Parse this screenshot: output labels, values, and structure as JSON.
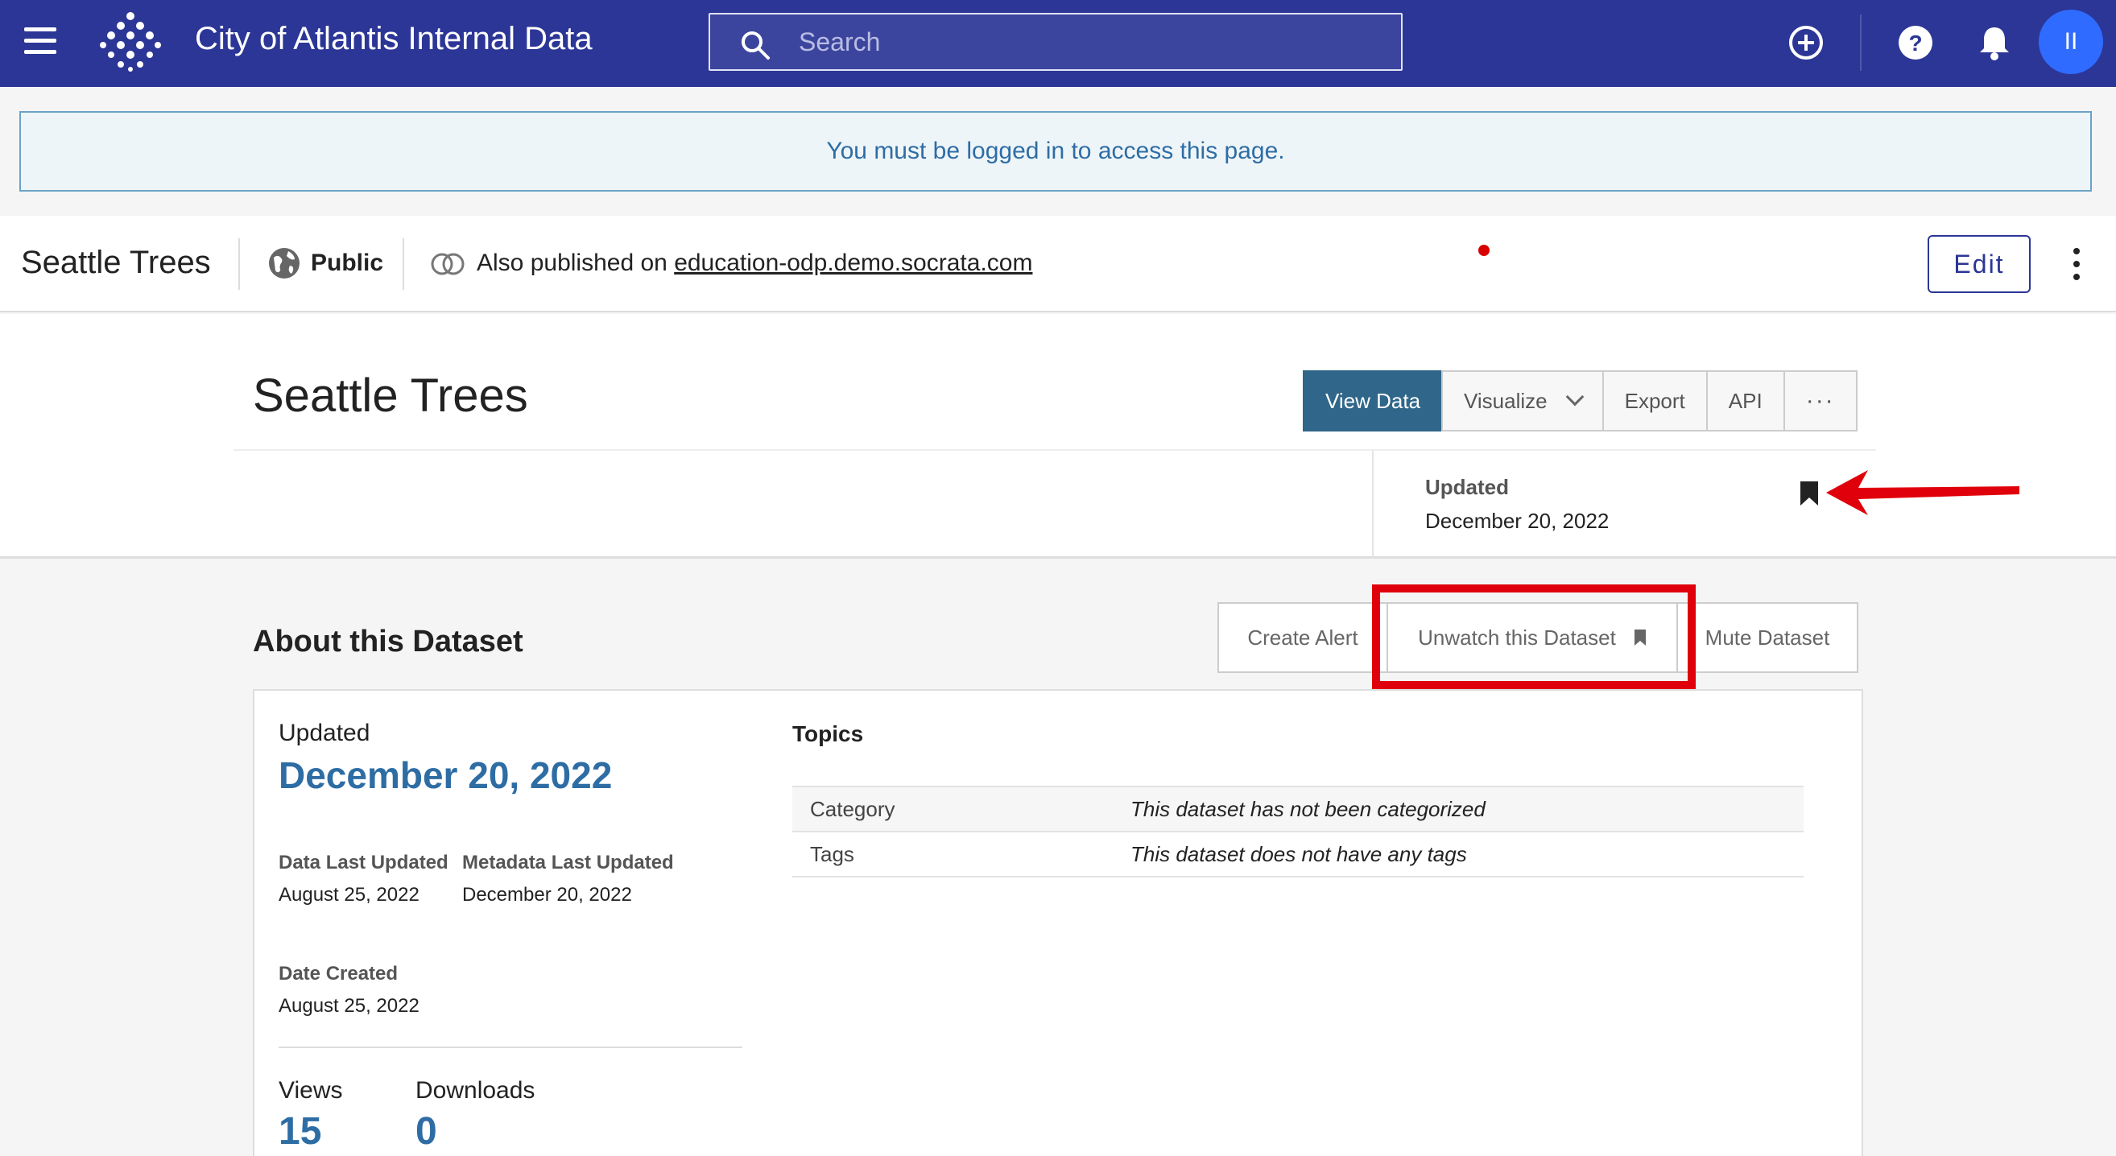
{
  "header": {
    "app_title": "City of Atlantis Internal Data",
    "search_placeholder": "Search",
    "avatar_initials": "II",
    "icons": [
      "menu-icon",
      "logo-icon",
      "search-icon",
      "add-circle-icon",
      "help-icon",
      "bell-icon"
    ]
  },
  "alert": {
    "message": "You must be logged in to access this page."
  },
  "asset_bar": {
    "name": "Seattle Trees",
    "visibility": "Public",
    "published_prefix": "Also published on",
    "published_link": "education-odp.demo.socrata.com",
    "edit_label": "Edit"
  },
  "title_section": {
    "title": "Seattle Trees",
    "buttons": {
      "view_data": "View Data",
      "visualize": "Visualize",
      "export": "Export",
      "api": "API",
      "more": "···"
    },
    "updated_label": "Updated",
    "updated_date": "December 20, 2022"
  },
  "about": {
    "title": "About this Dataset",
    "actions": {
      "create_alert": "Create Alert",
      "unwatch": "Unwatch this Dataset",
      "mute": "Mute Dataset"
    },
    "updated_label": "Updated",
    "updated_date": "December 20, 2022",
    "data_last_updated_label": "Data Last Updated",
    "data_last_updated": "August 25, 2022",
    "metadata_last_updated_label": "Metadata Last Updated",
    "metadata_last_updated": "December 20, 2022",
    "date_created_label": "Date Created",
    "date_created": "August 25, 2022",
    "views_label": "Views",
    "views": "15",
    "downloads_label": "Downloads",
    "downloads": "0",
    "topics_title": "Topics",
    "topics": [
      {
        "label": "Category",
        "value": "This dataset has not been categorized"
      },
      {
        "label": "Tags",
        "value": "This dataset does not have any tags"
      }
    ]
  },
  "colors": {
    "header_bg": "#2c3696",
    "accent_blue": "#2e6da4",
    "primary_button": "#2f6689",
    "annotation_red": "#e0000b"
  }
}
